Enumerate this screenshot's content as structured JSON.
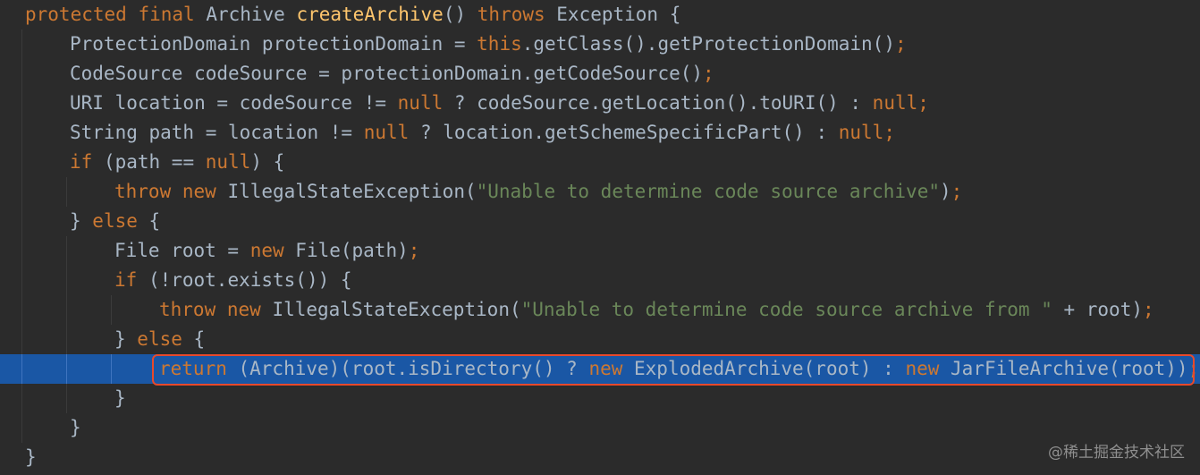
{
  "editor": {
    "highlighted_line": 13,
    "lines": [
      {
        "indent": 0,
        "tokens": [
          {
            "t": "protected",
            "c": "kw"
          },
          {
            "t": " ",
            "c": "plain"
          },
          {
            "t": "final",
            "c": "kw"
          },
          {
            "t": " Archive ",
            "c": "plain"
          },
          {
            "t": "createArchive",
            "c": "fn"
          },
          {
            "t": "() ",
            "c": "plain"
          },
          {
            "t": "throws",
            "c": "kw"
          },
          {
            "t": " Exception {",
            "c": "plain"
          }
        ]
      },
      {
        "indent": 1,
        "tokens": [
          {
            "t": "ProtectionDomain protectionDomain = ",
            "c": "plain"
          },
          {
            "t": "this",
            "c": "kw"
          },
          {
            "t": ".getClass().getProtectionDomain()",
            "c": "plain"
          },
          {
            "t": ";",
            "c": "kw"
          }
        ]
      },
      {
        "indent": 1,
        "tokens": [
          {
            "t": "CodeSource codeSource = protectionDomain.getCodeSource()",
            "c": "plain"
          },
          {
            "t": ";",
            "c": "kw"
          }
        ]
      },
      {
        "indent": 1,
        "tokens": [
          {
            "t": "URI location = codeSource != ",
            "c": "plain"
          },
          {
            "t": "null",
            "c": "kw"
          },
          {
            "t": " ? codeSource.getLocation().toURI() : ",
            "c": "plain"
          },
          {
            "t": "null",
            "c": "kw"
          },
          {
            "t": ";",
            "c": "kw"
          }
        ]
      },
      {
        "indent": 1,
        "tokens": [
          {
            "t": "String path = location != ",
            "c": "plain"
          },
          {
            "t": "null",
            "c": "kw"
          },
          {
            "t": " ? location.getSchemeSpecificPart() : ",
            "c": "plain"
          },
          {
            "t": "null",
            "c": "kw"
          },
          {
            "t": ";",
            "c": "kw"
          }
        ]
      },
      {
        "indent": 1,
        "tokens": [
          {
            "t": "if",
            "c": "kw"
          },
          {
            "t": " (path == ",
            "c": "plain"
          },
          {
            "t": "null",
            "c": "kw"
          },
          {
            "t": ") {",
            "c": "plain"
          }
        ]
      },
      {
        "indent": 2,
        "tokens": [
          {
            "t": "throw",
            "c": "kw"
          },
          {
            "t": " ",
            "c": "plain"
          },
          {
            "t": "new",
            "c": "kw"
          },
          {
            "t": " IllegalStateException(",
            "c": "plain"
          },
          {
            "t": "\"Unable to determine code source archive\"",
            "c": "str"
          },
          {
            "t": ")",
            "c": "plain"
          },
          {
            "t": ";",
            "c": "kw"
          }
        ]
      },
      {
        "indent": 1,
        "tokens": [
          {
            "t": "} ",
            "c": "plain"
          },
          {
            "t": "else",
            "c": "kw"
          },
          {
            "t": " {",
            "c": "plain"
          }
        ]
      },
      {
        "indent": 2,
        "tokens": [
          {
            "t": "File root = ",
            "c": "plain"
          },
          {
            "t": "new",
            "c": "kw"
          },
          {
            "t": " File(path)",
            "c": "plain"
          },
          {
            "t": ";",
            "c": "kw"
          }
        ]
      },
      {
        "indent": 2,
        "tokens": [
          {
            "t": "if",
            "c": "kw"
          },
          {
            "t": " (!root.exists()) {",
            "c": "plain"
          }
        ]
      },
      {
        "indent": 3,
        "tokens": [
          {
            "t": "throw",
            "c": "kw"
          },
          {
            "t": " ",
            "c": "plain"
          },
          {
            "t": "new",
            "c": "kw"
          },
          {
            "t": " IllegalStateException(",
            "c": "plain"
          },
          {
            "t": "\"Unable to determine code source archive from \"",
            "c": "str"
          },
          {
            "t": " + root)",
            "c": "plain"
          },
          {
            "t": ";",
            "c": "kw"
          }
        ]
      },
      {
        "indent": 2,
        "tokens": [
          {
            "t": "} ",
            "c": "plain"
          },
          {
            "t": "else",
            "c": "kw"
          },
          {
            "t": " {",
            "c": "plain"
          }
        ]
      },
      {
        "indent": 3,
        "tokens": [
          {
            "t": "return",
            "c": "kw"
          },
          {
            "t": " (Archive)(root.isDirectory() ? ",
            "c": "plain"
          },
          {
            "t": "new",
            "c": "kw"
          },
          {
            "t": " ExplodedArchive(root) : ",
            "c": "plain"
          },
          {
            "t": "new",
            "c": "kw"
          },
          {
            "t": " JarFileArchive(root))",
            "c": "plain"
          },
          {
            "t": ";",
            "c": "kw"
          }
        ]
      },
      {
        "indent": 2,
        "tokens": [
          {
            "t": "}",
            "c": "plain"
          }
        ]
      },
      {
        "indent": 1,
        "tokens": [
          {
            "t": "}",
            "c": "plain"
          }
        ]
      },
      {
        "indent": 0,
        "tokens": [
          {
            "t": "}",
            "c": "plain"
          }
        ]
      }
    ]
  },
  "watermark": "@稀土掘金技术社区"
}
